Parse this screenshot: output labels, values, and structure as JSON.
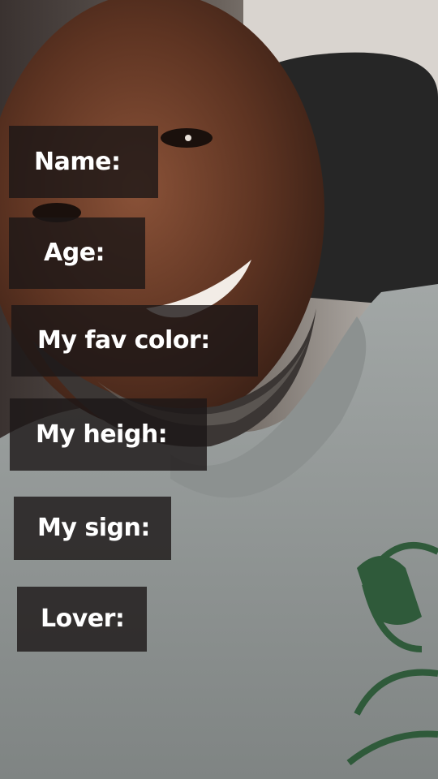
{
  "photo": {
    "description_icon": "selfie-photo"
  },
  "labels": {
    "name": "Name:",
    "age": "Age:",
    "fav_color": "My fav color:",
    "height": "My heigh:",
    "sign": "My sign:",
    "lover": "Lover:"
  },
  "colors": {
    "label_bg": "#1c1616",
    "label_text": "#ffffff",
    "shirt": "#8f9493",
    "shirt_print": "#2f5a3a",
    "skin": "#6b3e2a",
    "car_interior": "#2a2a2a"
  }
}
